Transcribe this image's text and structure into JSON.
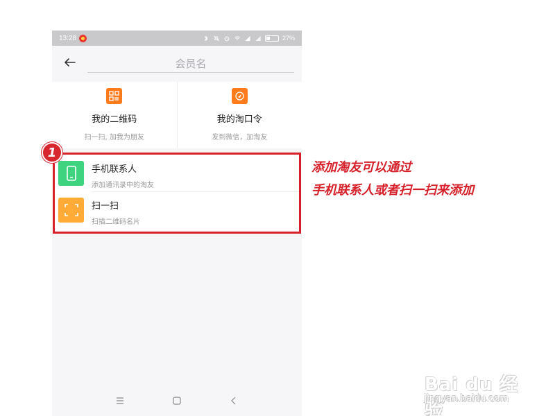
{
  "status_bar": {
    "time": "13:28",
    "battery_text": "27%",
    "battery_level": 0.27
  },
  "header": {
    "back_icon": "arrow-left-icon",
    "search_placeholder": "会员名"
  },
  "cards": [
    {
      "icon": "qr-code-icon",
      "title": "我的二维码",
      "subtitle": "扫一扫, 加我为朋友"
    },
    {
      "icon": "taokouling-icon",
      "title": "我的淘口令",
      "subtitle": "发到微信，加淘友"
    }
  ],
  "list": [
    {
      "icon": "phone-contact-icon",
      "title": "手机联系人",
      "subtitle": "添加通讯录中的淘友"
    },
    {
      "icon": "scan-icon",
      "title": "扫一扫",
      "subtitle": "扫描二维码名片"
    }
  ],
  "annotation": {
    "step": "1",
    "line1": "添加淘友可以通过",
    "line2": "手机联系人或者扫一扫来添加"
  },
  "watermark": {
    "text": "Bai du 经验",
    "url": "jingyan.baidu.com"
  },
  "colors": {
    "accent": "#d6202a",
    "orange": "#ff7b1c",
    "green": "#3dd37f",
    "yellow": "#ffab35"
  }
}
